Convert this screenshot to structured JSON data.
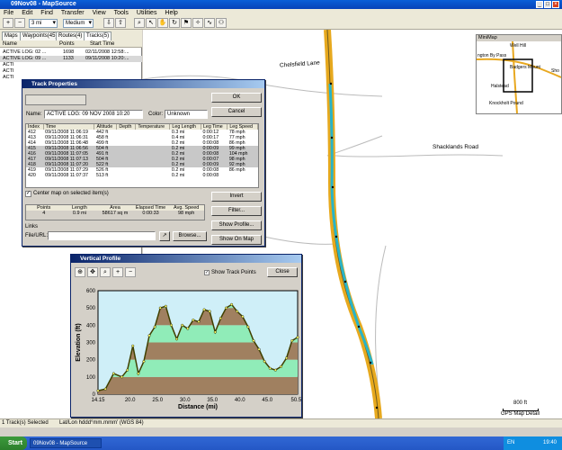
{
  "window": {
    "title": "09Nov08 - MapSource"
  },
  "menu": [
    "File",
    "Edit",
    "Find",
    "Transfer",
    "View",
    "Tools",
    "Utilities",
    "Help"
  ],
  "toolbar": {
    "zoom_value": "3 mi",
    "detail_value": "Medium"
  },
  "left": {
    "tabs": [
      "Maps",
      "Waypoints(45)",
      "Routes(4)",
      "Tracks(5)"
    ],
    "headers": [
      "Name",
      "Points",
      "Start Time"
    ],
    "rows": [
      {
        "name": "ACTIVE LOG: 02 ...",
        "points": "1698",
        "time": "02/11/2008 12:58:..."
      },
      {
        "name": "ACTIVE LOG: 09 ...",
        "points": "1133",
        "time": "09/11/2008 10:20:..."
      },
      {
        "name": "ACTI",
        "points": "",
        "time": ""
      },
      {
        "name": "ACTI",
        "points": "",
        "time": ""
      },
      {
        "name": "ACTI",
        "points": "",
        "time": ""
      }
    ]
  },
  "map": {
    "labels": {
      "chelsfield": "Chelsfield Lane",
      "shacklands": "Shacklands Road"
    },
    "scale": "800 ft",
    "detail": "GPS Map Detail",
    "minimap": {
      "title": "MiniMap",
      "places": [
        "Well Hill",
        "ngton By Pass",
        "Badgers Mount",
        "Sho",
        "Halstead",
        "Knockholt Pound"
      ]
    }
  },
  "status": {
    "selected": "1 Track(s) Selected",
    "format": "Lat/Lon hddd°mm.mmm' (WGS 84)"
  },
  "taskbar": {
    "start": "Start",
    "task": "09Nov08 - MapSource",
    "lang": "EN",
    "time": "19:40"
  },
  "trackprops": {
    "title": "Track Properties",
    "ok": "OK",
    "cancel": "Cancel",
    "name_label": "Name:",
    "name_value": "ACTIVE LOG: 09 NOV 2008 10:20",
    "color_label": "Color:",
    "color_value": "Unknown",
    "headers": [
      "Index",
      "Time",
      "Altitude",
      "Depth",
      "Temperature",
      "Leg Length",
      "Leg Time",
      "Leg Speed"
    ],
    "rows": [
      [
        "412",
        "09/11/2008 11:06:19",
        "442 ft",
        "",
        "",
        "0.3 mi",
        "0:00:12",
        "78 mph"
      ],
      [
        "413",
        "09/11/2008 11:06:31",
        "458 ft",
        "",
        "",
        "0.4 mi",
        "0:00:17",
        "77 mph"
      ],
      [
        "414",
        "09/11/2008 11:06:48",
        "499 ft",
        "",
        "",
        "0.2 mi",
        "0:00:08",
        "86 mph"
      ],
      [
        "415",
        "09/11/2008 11:06:56",
        "504 ft",
        "",
        "",
        "0.2 mi",
        "0:00:09",
        "99 mph"
      ],
      [
        "416",
        "09/11/2008 11:07:05",
        "491 ft",
        "",
        "",
        "0.2 mi",
        "0:00:08",
        "104 mph"
      ],
      [
        "417",
        "09/11/2008 11:07:13",
        "504 ft",
        "",
        "",
        "0.2 mi",
        "0:00:07",
        "98 mph"
      ],
      [
        "418",
        "09/11/2008 11:07:20",
        "522 ft",
        "",
        "",
        "0.2 mi",
        "0:00:09",
        "92 mph"
      ],
      [
        "419",
        "09/11/2008 11:07:29",
        "526 ft",
        "",
        "",
        "0.2 mi",
        "0:00:08",
        "86 mph"
      ],
      [
        "420",
        "09/11/2008 11:07:37",
        "513 ft",
        "",
        "",
        "0.2 mi",
        "0:00:08",
        "",
        ""
      ]
    ],
    "center_label": "Center map on selected item(s)",
    "invert": "Invert",
    "filter": "Filter...",
    "stats_headers": [
      "Points",
      "Length",
      "Area",
      "Elapsed Time",
      "Avg. Speed"
    ],
    "stats_values": [
      "4",
      "0.9 mi",
      "58617 sq m",
      "0:00:33",
      "98 mph"
    ],
    "links_label": "Links",
    "fileurl_label": "File/URL:",
    "browse": "Browse...",
    "showprofile": "Show Profile...",
    "showonmap": "Show On Map"
  },
  "profile": {
    "title": "Vertical Profile",
    "show_track_points": "Show Track Points",
    "close": "Close",
    "ylabel": "Elevation (ft)",
    "xlabel": "Distance   (mi)"
  },
  "chart_data": {
    "type": "area",
    "xlabel": "Distance   (mi)",
    "ylabel": "Elevation (ft)",
    "xlim": [
      14.15,
      50.53
    ],
    "ylim": [
      0,
      600
    ],
    "x_ticks": [
      "14.15",
      "20.0",
      "25.0",
      "30.0",
      "35.0",
      "40.0",
      "45.0",
      "50.53"
    ],
    "y_ticks": [
      "0",
      "100",
      "200",
      "300",
      "400",
      "500",
      "600"
    ],
    "x": [
      14.15,
      15.5,
      17,
      18.5,
      19.5,
      20.5,
      21.5,
      22.5,
      23.5,
      24.5,
      25.5,
      26.5,
      27.5,
      28.5,
      29.5,
      30.5,
      31.5,
      32.5,
      33.5,
      34.5,
      35.5,
      36.5,
      37.5,
      38.5,
      39.5,
      40.5,
      41.5,
      42.5,
      43.5,
      44.5,
      45.5,
      46.5,
      47.5,
      48.5,
      49.5,
      50.53
    ],
    "y": [
      20,
      30,
      120,
      100,
      140,
      280,
      120,
      190,
      340,
      390,
      500,
      510,
      400,
      320,
      400,
      380,
      430,
      420,
      490,
      480,
      360,
      440,
      500,
      520,
      480,
      450,
      390,
      310,
      260,
      190,
      150,
      140,
      160,
      210,
      310,
      330
    ],
    "colors": {
      "band_brown": "#a08060",
      "band_green": "#90ecb8",
      "plot_bg": "#cfeff8",
      "line": "#404000"
    }
  }
}
